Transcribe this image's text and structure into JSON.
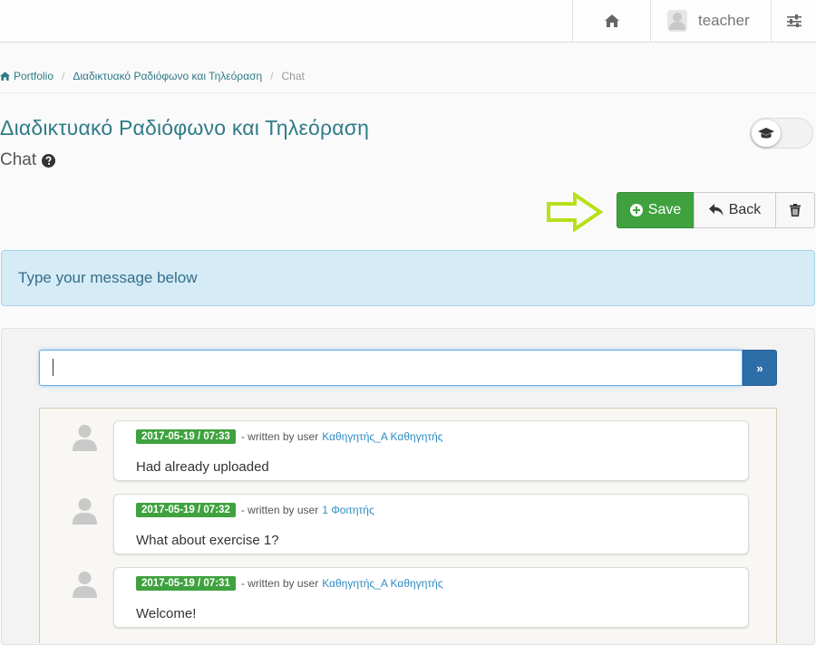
{
  "nav": {
    "user_name": "teacher"
  },
  "breadcrumb": [
    {
      "label": "Portfolio"
    },
    {
      "label": "Διαδικτυακό Ραδιόφωνο και Τηλεόραση"
    },
    {
      "label": "Chat"
    }
  ],
  "header": {
    "title": "Διαδικτυακό Ραδιόφωνο και Τηλεόραση",
    "subtitle": "Chat"
  },
  "toolbar": {
    "save_label": "Save",
    "back_label": "Back"
  },
  "alert": {
    "text": "Type your message below"
  },
  "chat": {
    "input_value": "",
    "send_label": "»",
    "messages": [
      {
        "date": "2017-05-19 / 07:33",
        "written_by": "- written by user",
        "user": "Καθηγητής_Α Καθηγητής",
        "text": "Had already uploaded"
      },
      {
        "date": "2017-05-19 / 07:32",
        "written_by": "- written by user",
        "user": "1 Φοιτητής",
        "text": "What about exercise 1?"
      },
      {
        "date": "2017-05-19 / 07:31",
        "written_by": "- written by user",
        "user": "Καθηγητής_Α Καθηγητής",
        "text": "Welcome!"
      }
    ]
  },
  "colors": {
    "accent": "#2f7b88",
    "save_green": "#3fa23f",
    "send_blue": "#2e6ea8",
    "alert_bg": "#d5ebf6",
    "arrow_green": "#b6e01b"
  }
}
